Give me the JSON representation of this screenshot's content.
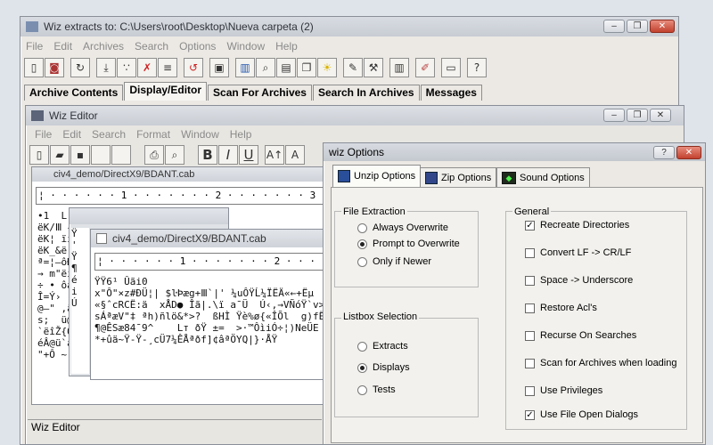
{
  "main_window": {
    "title": "Wiz extracts to: C:\\Users\\root\\Desktop\\Nueva carpeta (2)",
    "menu": [
      "File",
      "Edit",
      "Archives",
      "Search",
      "Options",
      "Window",
      "Help"
    ],
    "tabs": [
      "Archive Contents",
      "Display/Editor",
      "Scan For Archives",
      "Search In Archives",
      "Messages"
    ],
    "active_tab": "Display/Editor",
    "caption_buttons": [
      "–",
      "❐",
      "✕"
    ]
  },
  "editor_window": {
    "title": "Wiz Editor",
    "menu": [
      "File",
      "Edit",
      "Search",
      "Format",
      "Window",
      "Help"
    ],
    "format_buttons": [
      "B",
      "I",
      "U",
      "A↑",
      "A"
    ],
    "status": "Wiz Editor",
    "doc1_title": "civ4_demo/DirectX9/BDANT.cab",
    "doc2_title": "civ4_demo/DirectX9/BDANT.cab",
    "ruler": "¦ · · · · · · 1 · · · · · · · 2 · · · · · · · 3 · · · · · · · 4",
    "doc1_lines": [
      "•1  L",
      "ëK/Ⅲ –",
      "ëK¦ ïiÜ",
      "ëK_&ë",
      "ª=¦–ôÐ",
      "→ m\"ëi",
      "÷ • ôå",
      "Î=Ý›  ",
      "@–\" ,ä",
      "s;  ü@",
      "`ëîŽ{Ô",
      "éÂ@ü`a",
      "\"+Ô ~"
    ],
    "doc2_lines": [
      "ŸŸ6¹ Ûãi0",
      "x\"Ô\"×z#ÐÜ¦| $ŀÞæg+Ⅲ`|' ¼uÔŸĹ¼ÏËÄ«←+Ëµ",
      "«§ˆcRCË:ä  xÅD● Îã|.\\ï a¯Ü  Ú‹,→VÑóŸ`v>a",
      "sÁªæV\"‡ ªh)ñlö&*>?  ßHÌ Ÿè%ø{«ÎÕl  g)fË<",
      "¶@ÊSæ84¯9^    Lт ðŸ ±=  >·™ÔìiÓ÷¦)NeÜE",
      "*+ûä~Ÿ-Ÿ-¸cÜ7¼ÊÅªðf]¢âªÖYQ|}·ÅŸ"
    ],
    "left_strip": [
      "Ÿ",
      "'",
      "Ÿ",
      "¶",
      "é",
      "i",
      "Ú"
    ]
  },
  "options_dialog": {
    "title": "wiz Options",
    "tabs": [
      {
        "label": "Unzip Options",
        "icon": "unzip-icon",
        "active": true
      },
      {
        "label": "Zip Options",
        "icon": "zip-icon",
        "active": false
      },
      {
        "label": "Sound Options",
        "icon": "sound-icon",
        "active": false
      }
    ],
    "file_extraction": {
      "label": "File Extraction",
      "options": [
        {
          "label": "Always Overwrite",
          "selected": false
        },
        {
          "label": "Prompt to Overwrite",
          "selected": true
        },
        {
          "label": "Only if Newer",
          "selected": false
        }
      ]
    },
    "listbox_selection": {
      "label": "Listbox Selection",
      "options": [
        {
          "label": "Extracts",
          "selected": false
        },
        {
          "label": "Displays",
          "selected": true
        },
        {
          "label": "Tests",
          "selected": false
        }
      ]
    },
    "general": {
      "label": "General",
      "options": [
        {
          "label": "Recreate Directories",
          "checked": true
        },
        {
          "label": "Convert LF -> CR/LF",
          "checked": false
        },
        {
          "label": "Space -> Underscore",
          "checked": false
        },
        {
          "label": "Restore Acl's",
          "checked": false
        },
        {
          "label": "Recurse On Searches",
          "checked": false
        },
        {
          "label": "Scan for Archives when loading",
          "checked": false
        },
        {
          "label": "Use Privileges",
          "checked": false
        },
        {
          "label": "Use File Open Dialogs",
          "checked": true
        }
      ]
    }
  }
}
